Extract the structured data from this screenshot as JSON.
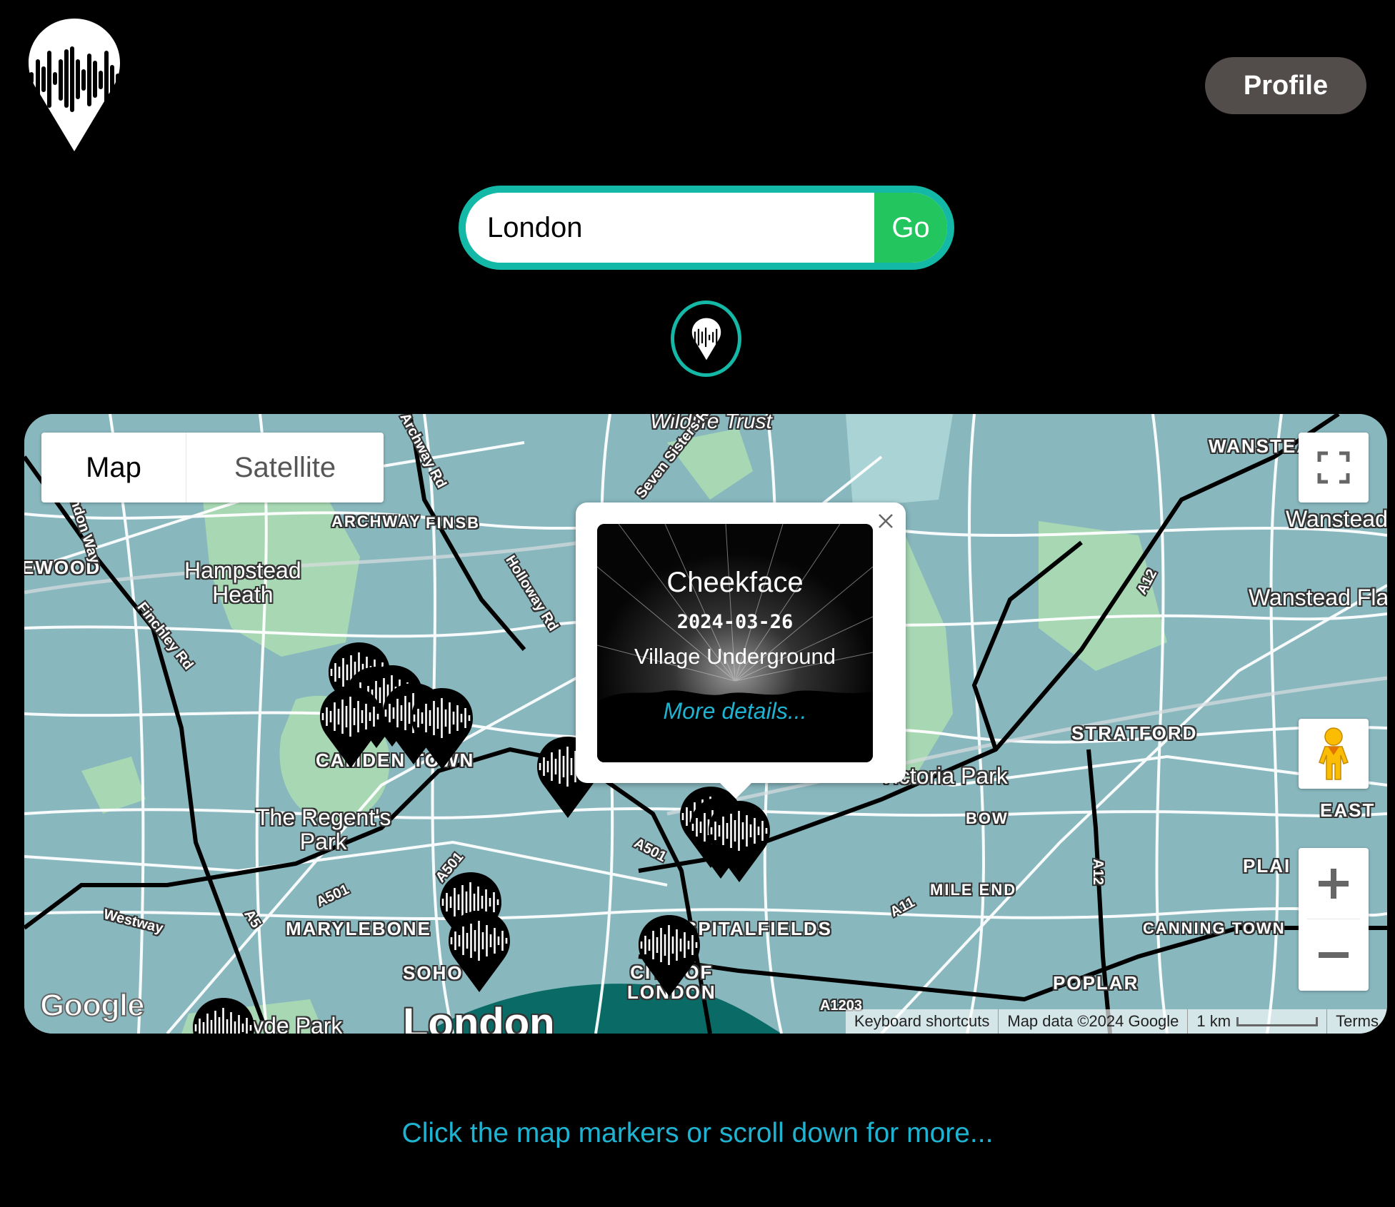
{
  "header": {
    "logo_icon": "sound-wave-pin-icon",
    "profile_label": "Profile"
  },
  "search": {
    "value": "London",
    "placeholder": "",
    "go_label": "Go",
    "locate_icon": "sound-wave-pin-icon"
  },
  "map": {
    "type_options": [
      "Map",
      "Satellite"
    ],
    "selected_type": "Map",
    "controls": {
      "fullscreen_icon": "fullscreen-icon",
      "street_view_icon": "pegman-icon",
      "zoom_in_icon": "plus-icon",
      "zoom_out_icon": "minus-icon"
    },
    "labels": {
      "wildlife_trust": "Wildlife Trust",
      "archway": "ARCHWAY",
      "finsbury": "FINSB",
      "hampstead": "Hampstead\nHeath",
      "hampstead_l1": "Hampstead",
      "hampstead_l2": "Heath",
      "golders": "EWOOD",
      "camden": "CAMDEN TOWN",
      "regents_l1": "The Regent's",
      "regents_l2": "Park",
      "marylebone": "MARYLEBONE",
      "soho": "SOHO",
      "city_l1": "CITY OF",
      "city_l2": "LONDON",
      "spitalfields": "SPITALFIELDS",
      "london": "London",
      "hyde_park": "Hyde Park",
      "victoria_park": "Victoria Park",
      "bow": "BOW",
      "mile_end": "MILE END",
      "stratford": "STRATFORD",
      "wanstead": "Wanstead",
      "wanstead_flats": "Wanstead Flats",
      "wanstead_caps": "WANSTEAD",
      "east_ham": "EAST",
      "plaistow": "PLAI",
      "canning_town": "CANNING TOWN",
      "poplar": "POPLAR",
      "finchley_rd": "Finchley Rd",
      "hendon_way": "Hendon Way",
      "holloway_rd": "Holloway Rd",
      "archway_rd": "Archway Rd",
      "seven_sisters_rd": "Seven Sisters Rd",
      "westway": "Westway",
      "a501": "A501",
      "a5": "A5",
      "a11": "A11",
      "a12": "A12",
      "a1203": "A1203"
    },
    "markers_count": 14,
    "info_window": {
      "title": "Cheekface",
      "date": "2024-03-26",
      "venue": "Village Underground",
      "link": "More details...",
      "close_icon": "close-icon"
    },
    "google_logo": "Google",
    "attribution": {
      "shortcuts": "Keyboard shortcuts",
      "data": "Map data ©2024 Google",
      "scale": "1 km",
      "terms": "Terms"
    }
  },
  "footer": {
    "hint": "Click the map markers or scroll down for more..."
  }
}
